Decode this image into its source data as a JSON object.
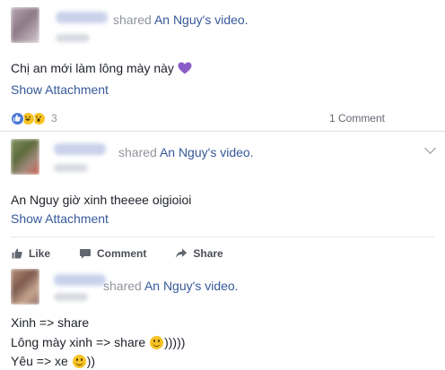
{
  "posts": [
    {
      "shared_word": "shared",
      "page_name": "An Nguy",
      "suffix": "'s video.",
      "text": "Chị an mới làm lông mày này",
      "emoji": "purple-heart-icon",
      "attachment": "Show Attachment",
      "reaction_count": "3",
      "reactions": [
        "like",
        "haha",
        "wow"
      ],
      "comments": "1 Comment"
    },
    {
      "shared_word": "shared",
      "page_name": "An Nguy",
      "suffix": "'s video.",
      "text": "An Nguy giờ xinh theeee oigioioi",
      "attachment": "Show Attachment",
      "actions": {
        "like": "Like",
        "comment": "Comment",
        "share": "Share"
      }
    },
    {
      "shared_word": "shared",
      "page_name": "An Nguy",
      "suffix": "'s video.",
      "line1": "Xinh => share",
      "line2_a": "Lông mày xinh => share ",
      "line2_b": ")))))",
      "line3_a": "Yêu => xe ",
      "line3_b": "))"
    }
  ],
  "colors": {
    "link": "#365899",
    "muted": "#90949c",
    "text": "#1d2129",
    "heart": "#8a5cc7"
  }
}
